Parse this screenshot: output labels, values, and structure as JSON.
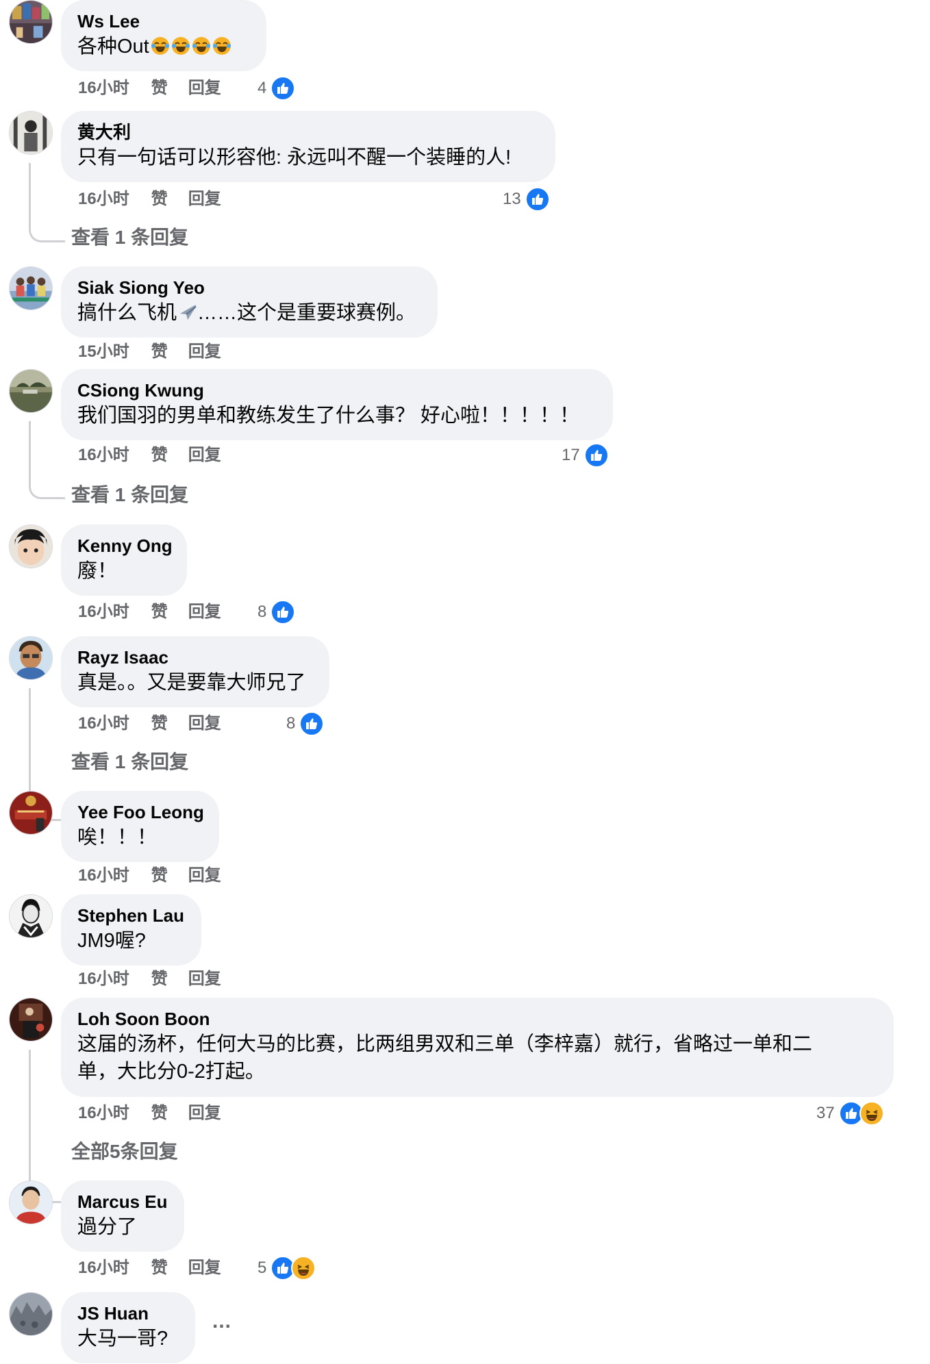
{
  "labels": {
    "like": "赞",
    "reply": "回复"
  },
  "comments": [
    {
      "author": "Ws Lee",
      "text": "各种Out",
      "emoji_count": 4,
      "emoji": "laughing-tears",
      "time": "16小时",
      "reactions": "4",
      "reaction_types": [
        "like"
      ]
    },
    {
      "author": "黄大利",
      "text": "只有一句话可以形容他: 永远叫不醒一个装睡的人!",
      "time": "16小时",
      "reactions": "13",
      "reaction_types": [
        "like"
      ],
      "replies_link": "查看 1 条回复"
    },
    {
      "author": "Siak Siong Yeo",
      "text_pre": "搞什么飞机",
      "text_post": "……这个是重要球赛例。",
      "emoji": "airplane",
      "time": "15小时"
    },
    {
      "author": "CSiong Kwung",
      "text": "我们国羽的男单和教练发生了什么事？ 好心啦！！！！！",
      "time": "16小时",
      "reactions": "17",
      "reaction_types": [
        "like"
      ],
      "replies_link": "查看 1 条回复"
    },
    {
      "author": "Kenny Ong",
      "text": "廢！",
      "time": "16小时",
      "reactions": "8",
      "reaction_types": [
        "like"
      ]
    },
    {
      "author": "Rayz Isaac",
      "text": "真是。。又是要靠大师兄了",
      "time": "16小时",
      "reactions": "8",
      "reaction_types": [
        "like"
      ],
      "replies_link": "查看 1 条回复"
    },
    {
      "author": "Yee Foo Leong",
      "text": "唉！！！",
      "time": "16小时"
    },
    {
      "author": "Stephen Lau",
      "text": "JM9喔?",
      "time": "16小时"
    },
    {
      "author": "Loh Soon Boon",
      "text": "这届的汤杯，任何大马的比赛，比两组男双和三单（李梓嘉）就行，省略过一单和二\n单，大比分0-2打起。",
      "time": "16小时",
      "reactions": "37",
      "reaction_types": [
        "like",
        "haha"
      ],
      "replies_link": "全部5条回复"
    },
    {
      "author": "Marcus Eu",
      "text": "過分了",
      "time": "16小时",
      "reactions": "5",
      "reaction_types": [
        "like",
        "haha"
      ]
    },
    {
      "author": "JS Huan",
      "text": "大马一哥?",
      "more": "..."
    }
  ],
  "colors": {
    "bubble": "#f0f2f5",
    "like": "#1877f2",
    "meta": "#65676b"
  }
}
